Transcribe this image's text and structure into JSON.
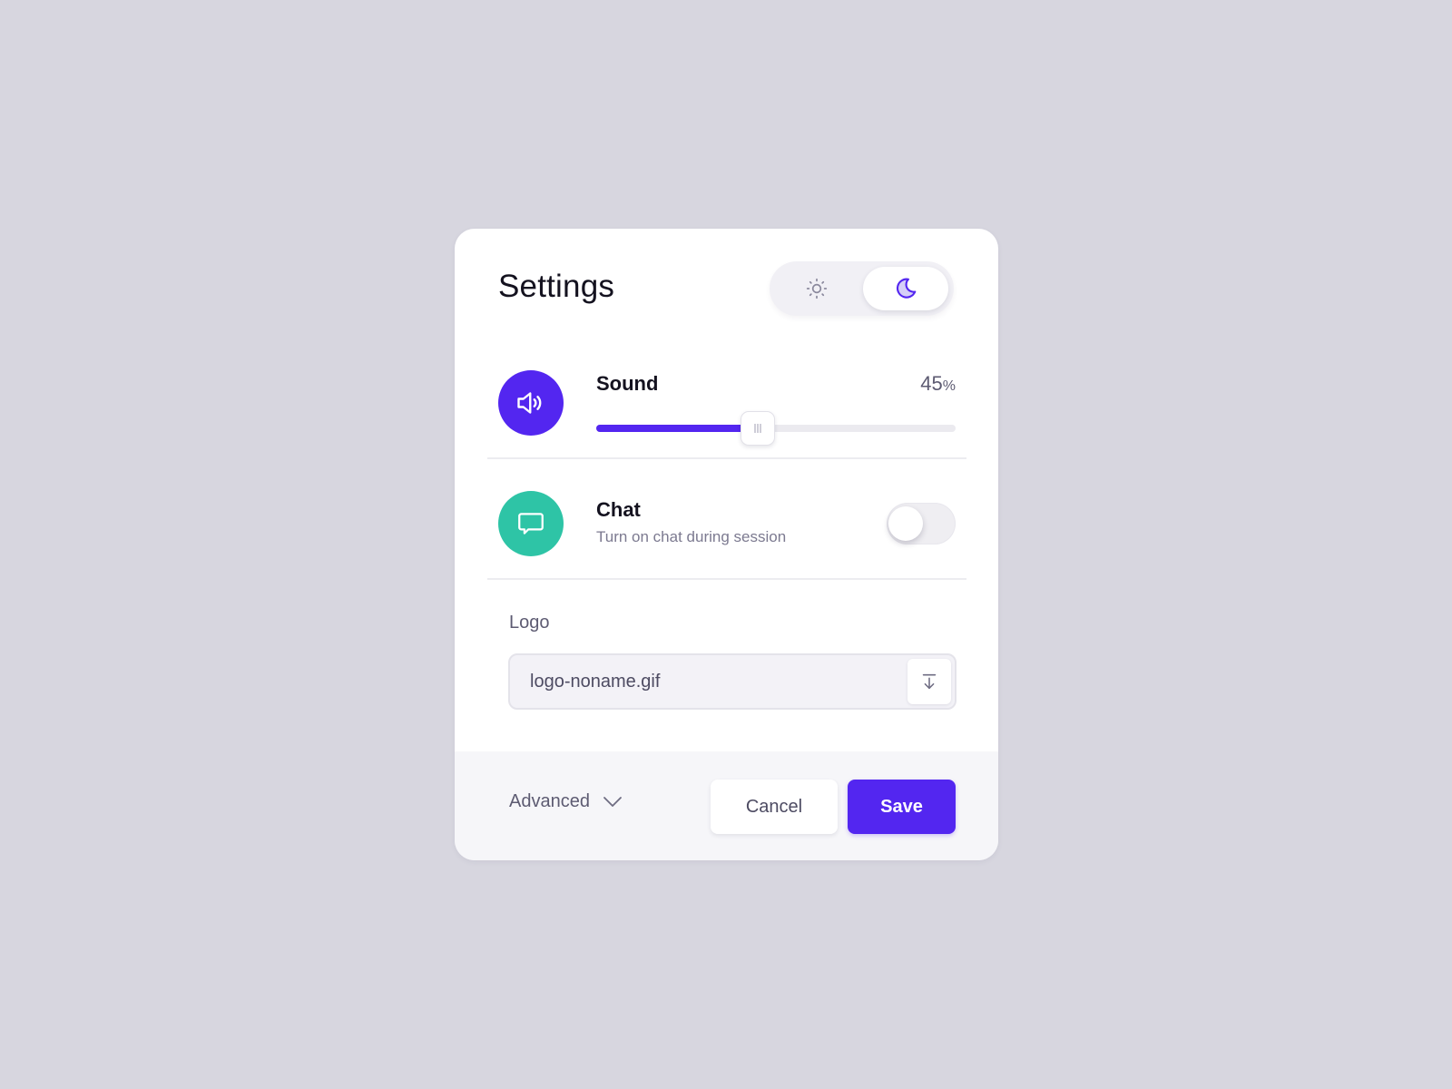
{
  "colors": {
    "accent": "#5326f0",
    "chat_icon_bg": "#2ec4a6",
    "background": "#d7d6df"
  },
  "header": {
    "title": "Settings",
    "theme_toggle": {
      "options": [
        {
          "id": "light",
          "icon": "sun-icon",
          "selected": false
        },
        {
          "id": "dark",
          "icon": "moon-icon",
          "selected": true
        }
      ]
    }
  },
  "sound": {
    "label": "Sound",
    "icon": "speaker-icon",
    "value": "45",
    "unit": "%",
    "level_percent": 45
  },
  "chat": {
    "label": "Chat",
    "icon": "chat-bubble-icon",
    "description": "Turn on chat during session",
    "enabled": false
  },
  "logo": {
    "label": "Logo",
    "file_name": "logo-noname.gif",
    "upload_icon": "upload-icon"
  },
  "footer": {
    "advanced_label": "Advanced",
    "cancel_label": "Cancel",
    "save_label": "Save"
  }
}
